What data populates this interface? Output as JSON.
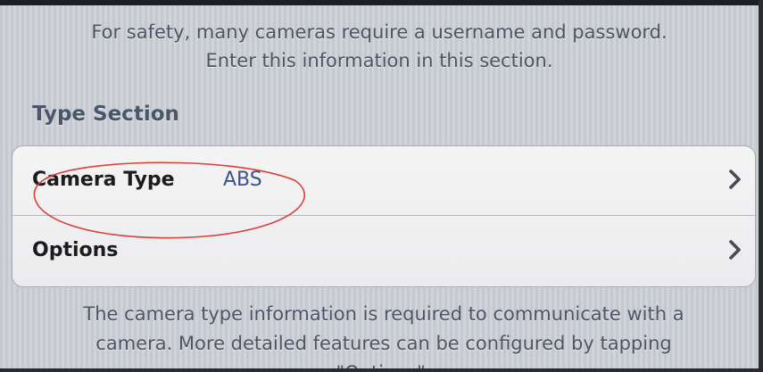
{
  "header": {
    "line1": "For safety, many cameras require a username and password.",
    "line2": "Enter this information in this section."
  },
  "section": {
    "title": "Type Section"
  },
  "rows": [
    {
      "label": "Camera Type",
      "value": "ABS",
      "icon": "chevron-right-icon"
    },
    {
      "label": "Options",
      "icon": "chevron-right-icon"
    }
  ],
  "footer": {
    "line1": "The camera type information is required to communicate with a",
    "line2": "camera. More detailed features can be configured by tapping",
    "line3": "\"Options\"."
  },
  "colors": {
    "background": "#c9ccd2",
    "group_background": "#f4f4f5",
    "value_text": "#3b5387",
    "annotation_ellipse": "#d9413b"
  }
}
